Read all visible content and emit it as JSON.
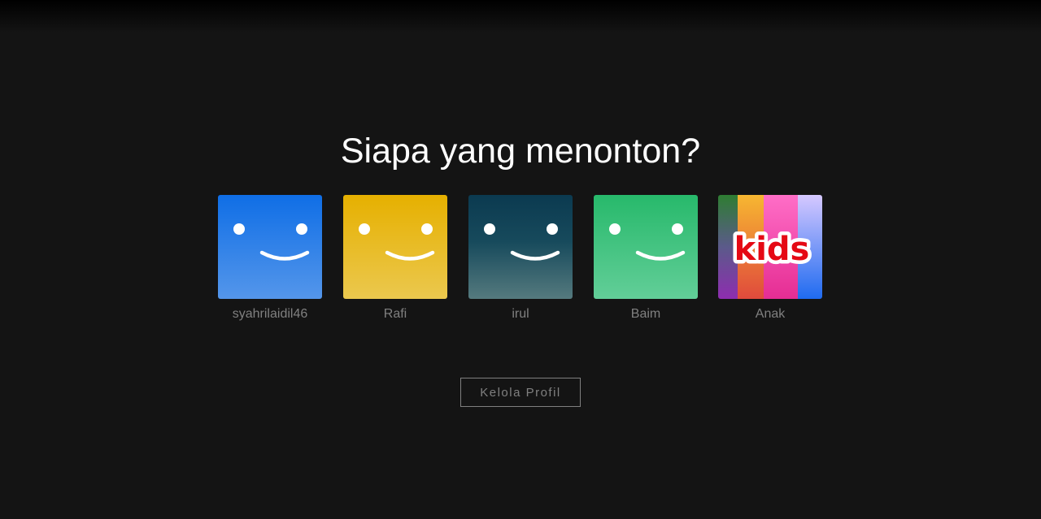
{
  "page": {
    "title": "Siapa yang menonton?"
  },
  "profiles": [
    {
      "name": "syahrilaidil46",
      "avatar": "smile-face-icon",
      "color_top": "#0f6ee6",
      "color_bottom": "#5496ea"
    },
    {
      "name": "Rafi",
      "avatar": "smile-face-icon",
      "color_top": "#e6b000",
      "color_bottom": "#ebc84e"
    },
    {
      "name": "irul",
      "avatar": "smile-face-icon",
      "color_top": "#0b3a50",
      "color_bottom": "#557a7e"
    },
    {
      "name": "Baim",
      "avatar": "smile-face-icon",
      "color_top": "#27b96b",
      "color_bottom": "#62ce98"
    },
    {
      "name": "Anak",
      "avatar": "kids-logo",
      "logo_text": "kids"
    }
  ],
  "manage_button": {
    "label": "Kelola Profil"
  },
  "colors": {
    "background": "#141414",
    "title": "#ffffff",
    "muted": "#808080",
    "kids_red": "#e50914"
  }
}
